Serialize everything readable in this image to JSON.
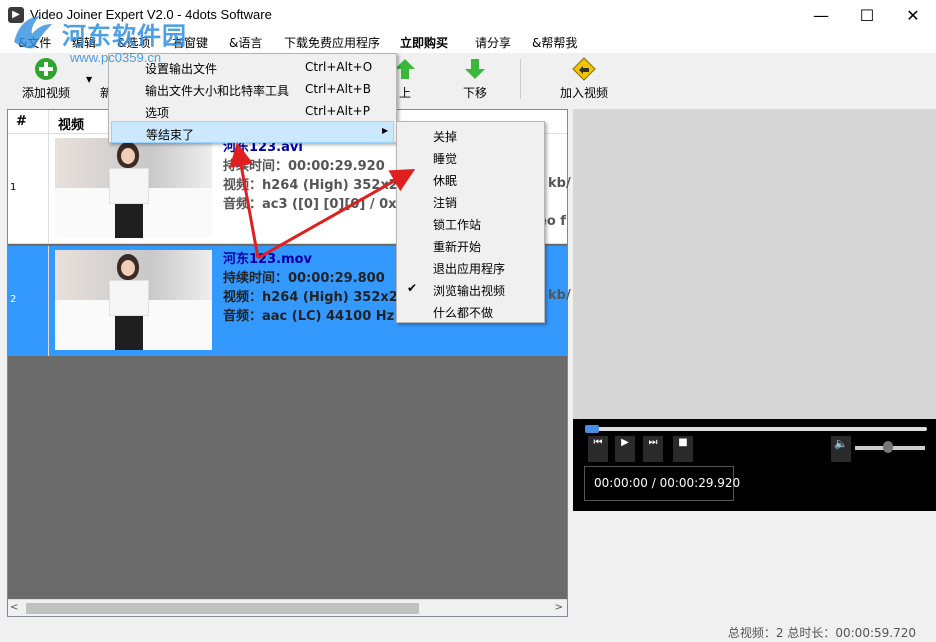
{
  "window": {
    "title": "Video Joiner Expert V2.0 - 4dots Software",
    "minimize": "—",
    "maximize": "☐",
    "close": "✕"
  },
  "watermark": {
    "title": "河东软件园",
    "url": "www.pc0359.cn"
  },
  "menubar": {
    "items": [
      "&文件",
      "编辑",
      "&选项",
      "右窗键",
      "&语言",
      "下载免费应用程序",
      "立即购买",
      "请分享",
      "&帮帮我"
    ]
  },
  "toolbar": {
    "add_video": "添加视频",
    "new": "新",
    "up": "上",
    "down": "下移",
    "join_video": "加入视频"
  },
  "list": {
    "col_hash": "#",
    "col_video": "视频",
    "rows": [
      {
        "num": "1",
        "name": "河东123.avi",
        "duration": "持续时间：00:00:29.920",
        "video": "视频：h264 (High) 352x288",
        "audio": "音频：ac3 ([0] [0][0] / 0x2000",
        "tail1": "kb/",
        "tail2": "eo f"
      },
      {
        "num": "2",
        "name": "河东123.mov",
        "duration": "持续时间：00:00:29.800",
        "video": "视频：h264 (High) 352x288",
        "audio": "音频：aac (LC) 44100 Hz 2",
        "tail1": "kb/",
        "tail2": ""
      }
    ],
    "scroll_left": "<",
    "scroll_right": ">"
  },
  "options_menu": {
    "items": [
      {
        "label": "设置输出文件",
        "shortcut": "Ctrl+Alt+O"
      },
      {
        "label": "输出文件大小和比特率工具",
        "shortcut": "Ctrl+Alt+B"
      },
      {
        "label": "选项",
        "shortcut": "Ctrl+Alt+P"
      },
      {
        "label": "等结束了",
        "shortcut": ""
      }
    ]
  },
  "submenu": {
    "items": [
      "关掉",
      "睡觉",
      "休眠",
      "注销",
      "锁工作站",
      "重新开始",
      "退出应用程序",
      "浏览输出视频",
      "什么都不做"
    ],
    "checked_index": 7
  },
  "player": {
    "time": "00:00:00 / 00:00:29.920",
    "seek_fraction": 0.0
  },
  "status": {
    "text": "总视频：2   总时长：00:00:59.720"
  },
  "colors": {
    "selection": "#3399ff",
    "name_text": "#0000aa",
    "annotation": "#e02020"
  }
}
